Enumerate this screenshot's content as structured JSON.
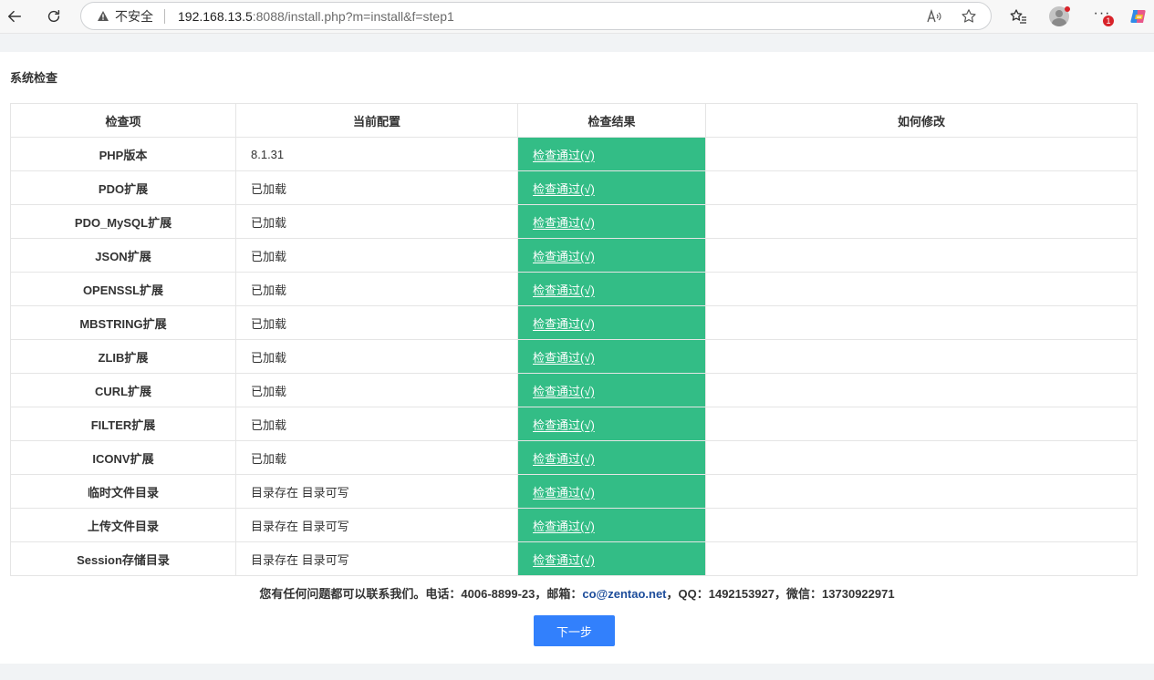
{
  "browser": {
    "insecure_label": "不安全",
    "url_host": "192.168.13.5",
    "url_path": ":8088/install.php?m=install&f=step1",
    "notifications_badge": "1"
  },
  "page": {
    "section_title": "系统检查",
    "columns": [
      "检查项",
      "当前配置",
      "检查结果",
      "如何修改"
    ],
    "rows": [
      {
        "item": "PHP版本",
        "config": "8.1.31",
        "result": "检查通过(√)",
        "fix": ""
      },
      {
        "item": "PDO扩展",
        "config": "已加载",
        "result": "检查通过(√)",
        "fix": ""
      },
      {
        "item": "PDO_MySQL扩展",
        "config": "已加载",
        "result": "检查通过(√)",
        "fix": ""
      },
      {
        "item": "JSON扩展",
        "config": "已加载",
        "result": "检查通过(√)",
        "fix": ""
      },
      {
        "item": "OPENSSL扩展",
        "config": "已加载",
        "result": "检查通过(√)",
        "fix": ""
      },
      {
        "item": "MBSTRING扩展",
        "config": "已加载",
        "result": "检查通过(√)",
        "fix": ""
      },
      {
        "item": "ZLIB扩展",
        "config": "已加载",
        "result": "检查通过(√)",
        "fix": ""
      },
      {
        "item": "CURL扩展",
        "config": "已加载",
        "result": "检查通过(√)",
        "fix": ""
      },
      {
        "item": "FILTER扩展",
        "config": "已加载",
        "result": "检查通过(√)",
        "fix": ""
      },
      {
        "item": "ICONV扩展",
        "config": "已加载",
        "result": "检查通过(√)",
        "fix": ""
      },
      {
        "item": "临时文件目录",
        "config": "目录存在 目录可写",
        "result": "检查通过(√)",
        "fix": ""
      },
      {
        "item": "上传文件目录",
        "config": "目录存在 目录可写",
        "result": "检查通过(√)",
        "fix": ""
      },
      {
        "item": "Session存储目录",
        "config": "目录存在 目录可写",
        "result": "检查通过(√)",
        "fix": ""
      }
    ],
    "contact_prefix": "您有任何问题都可以联系我们。电话：4006-8899-23，邮箱：",
    "contact_email": "co@zentao.net",
    "contact_suffix": "，QQ：1492153927，微信：13730922971",
    "next_button": "下一步"
  },
  "colors": {
    "pass_green": "#33bd86",
    "primary_blue": "#3280fc",
    "email_blue": "#1d4d9b"
  }
}
